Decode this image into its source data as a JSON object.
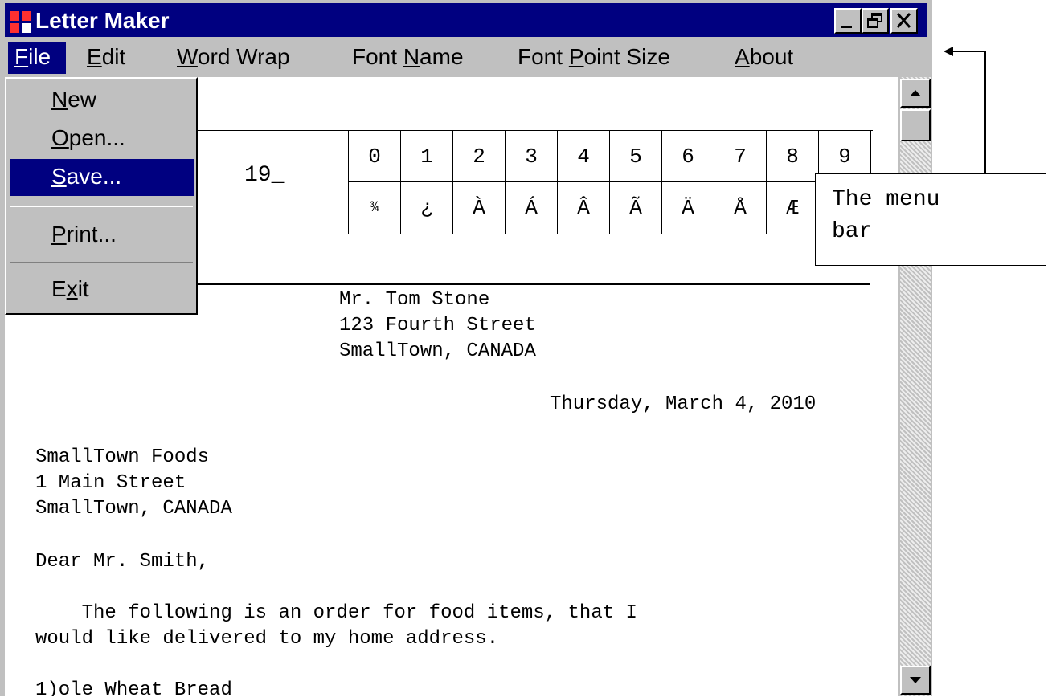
{
  "window": {
    "title": "Letter Maker",
    "controls": [
      "minimize-icon",
      "restore-icon",
      "close-icon"
    ]
  },
  "menubar": {
    "items": [
      {
        "pre": "",
        "key": "F",
        "post": "ile"
      },
      {
        "pre": "",
        "key": "E",
        "post": "dit"
      },
      {
        "pre": "",
        "key": "W",
        "post": "ord Wrap"
      },
      {
        "pre": "Font ",
        "key": "N",
        "post": "ame"
      },
      {
        "pre": "Font ",
        "key": "P",
        "post": "oint Size"
      },
      {
        "pre": "",
        "key": "A",
        "post": "bout"
      }
    ],
    "active_index": 0
  },
  "file_menu": {
    "items": [
      {
        "pre": "",
        "key": "N",
        "post": "ew"
      },
      {
        "pre": "",
        "key": "O",
        "post": "pen..."
      },
      {
        "pre": "",
        "key": "S",
        "post": "ave..."
      },
      {
        "pre": "",
        "key": "P",
        "post": "rint..."
      },
      {
        "pre": "E",
        "key": "x",
        "post": "it"
      }
    ],
    "highlighted_index": 2
  },
  "char_table": {
    "year": "19_",
    "digits": [
      "0",
      "1",
      "2",
      "3",
      "4",
      "5",
      "6",
      "7",
      "8",
      "9"
    ],
    "characters": [
      "¾",
      "¿",
      "À",
      "Á",
      "Â",
      "Ã",
      "Ä",
      "Å",
      "Æ",
      ""
    ]
  },
  "letter": {
    "sender_lines": [
      "Mr. Tom Stone",
      "123 Fourth Street",
      "SmallTown, CANADA"
    ],
    "date": "Thursday, March 4, 2010",
    "recipient_lines": [
      "SmallTown Foods",
      "1 Main Street",
      "SmallTown, CANADA"
    ],
    "salutation": "Dear Mr. Smith,",
    "body_lines": [
      "    The following is an order for food items, that I",
      "would like delivered to my home address."
    ],
    "partial_line": "1)ole Wheat Bread"
  },
  "callout": {
    "line1": "The menu",
    "line2": "bar"
  },
  "colors": {
    "titlebar": "#000080",
    "highlight": "#000080",
    "face": "#c0c0c0"
  }
}
